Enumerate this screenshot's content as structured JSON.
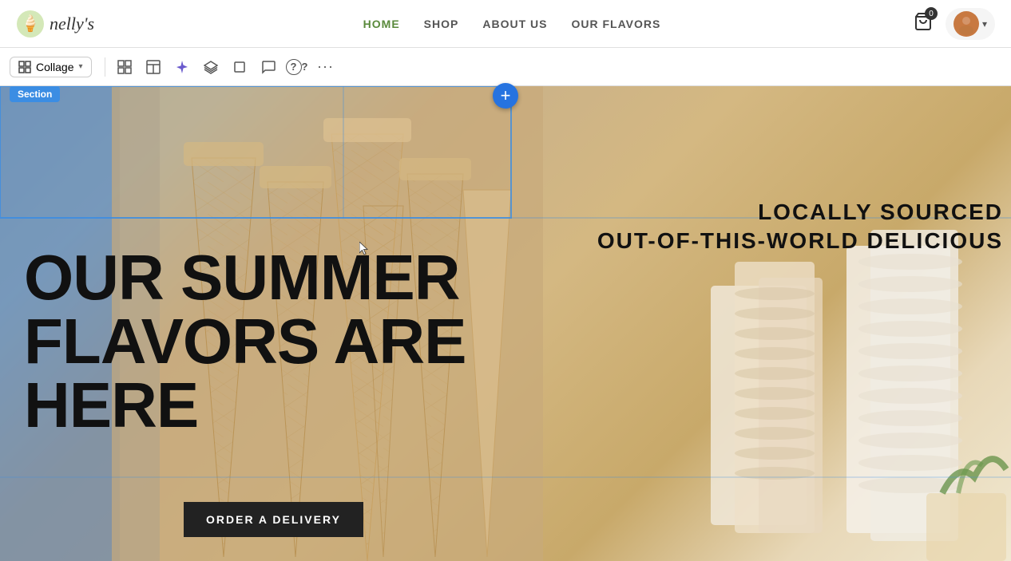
{
  "nav": {
    "logo_text": "nelly's",
    "links": [
      {
        "label": "HOME",
        "active": true
      },
      {
        "label": "SHOP",
        "active": false
      },
      {
        "label": "ABOUT US",
        "active": false
      },
      {
        "label": "OUR FLAVORS",
        "active": false
      }
    ],
    "cart_count": "0",
    "chevron_icon": "▾"
  },
  "toolbar": {
    "collage_label": "Collage",
    "grid_icon": "⊞",
    "layout_icon": "▤",
    "sparkle_icon": "✦",
    "layers_icon": "◈",
    "frame_icon": "⬜",
    "comment_icon": "💬",
    "help_icon": "?",
    "more_icon": "···"
  },
  "section": {
    "label": "Section"
  },
  "hero": {
    "headline_line1": "OUR SUMMER",
    "headline_line2": "FLAVORS ARE",
    "headline_line3": "HERE",
    "right_line1": "LOCALLY SOURCED",
    "right_line2": "OUT-OF-THIS-WORLD DELICIOUS",
    "cta_label": "ORDER A DELIVERY"
  },
  "add_btn": "+"
}
